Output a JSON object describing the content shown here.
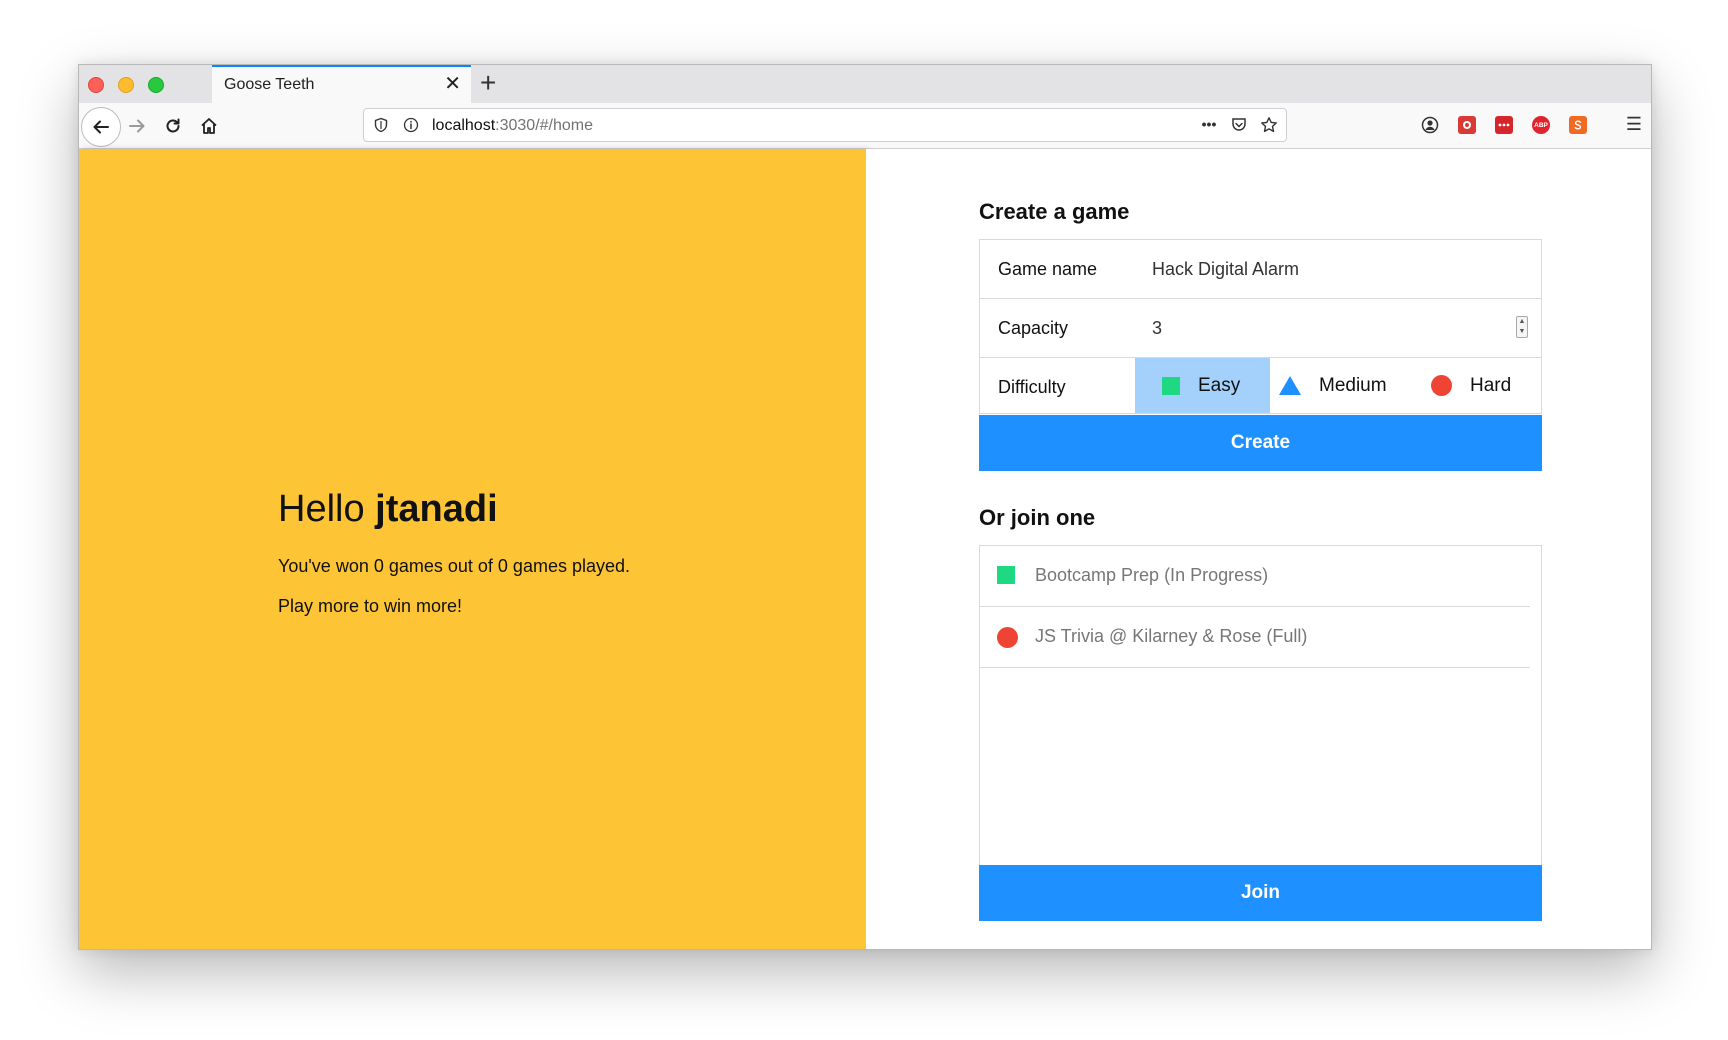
{
  "browser": {
    "tab_title": "Goose Teeth",
    "tab_close": "✕",
    "new_tab": "+",
    "url_host": "localhost",
    "url_rest": ":3030/#/home",
    "page_actions": "•••",
    "extensions": [
      "account-icon",
      "extension-icon-1",
      "extension-icon-2",
      "adblock-icon",
      "extension-icon-3"
    ],
    "adblock_label": "ABP",
    "menu_glyph": "☰"
  },
  "welcome": {
    "greeting": "Hello",
    "username": "jtanadi",
    "stats": "You've won 0 games out of 0 games played.",
    "motto": "Play more to win more!"
  },
  "create": {
    "title": "Create a game",
    "game_name_label": "Game name",
    "game_name_value": "Hack Digital Alarm",
    "capacity_label": "Capacity",
    "capacity_value": "3",
    "difficulty_label": "Difficulty",
    "difficulties": [
      {
        "label": "Easy",
        "shape": "square",
        "selected": true
      },
      {
        "label": "Medium",
        "shape": "triangle",
        "selected": false
      },
      {
        "label": "Hard",
        "shape": "circle",
        "selected": false
      }
    ],
    "button_label": "Create"
  },
  "join": {
    "title": "Or join one",
    "games": [
      {
        "label": "Bootcamp Prep (In Progress)",
        "shape": "square"
      },
      {
        "label": "JS Trivia @ Kilarney & Rose (Full)",
        "shape": "circle"
      }
    ],
    "button_label": "Join"
  },
  "colors": {
    "yellow_panel": "#fdc536",
    "accent_blue": "#1e90ff",
    "selected_blue": "#a3d1fb",
    "easy_green": "#1ed882",
    "hard_red": "#ee4433"
  }
}
